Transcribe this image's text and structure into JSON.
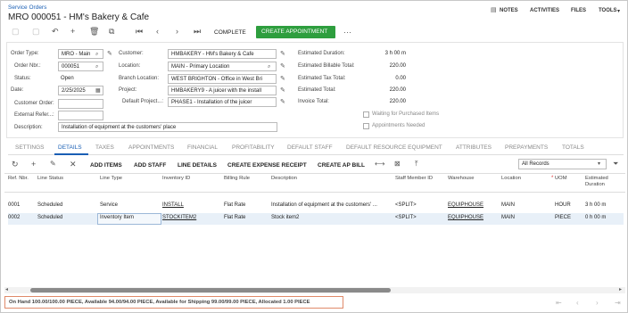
{
  "header": {
    "breadcrumb": "Service Orders",
    "title": "MRO 000051 - HM's Bakery & Cafe",
    "actions": [
      "NOTES",
      "ACTIVITIES",
      "FILES",
      "TOOLS"
    ]
  },
  "toolbar": {
    "complete_label": "COMPLETE",
    "create_appointment_label": "CREATE APPOINTMENT",
    "more_label": "···"
  },
  "form": {
    "order_type_label": "Order Type:",
    "order_type_value": "MRO - Main",
    "order_nbr_label": "Order Nbr.:",
    "order_nbr_value": "000051",
    "status_label": "Status:",
    "status_value": "Open",
    "date_label": "Date:",
    "date_value": "2/25/2025",
    "customer_order_label": "Customer Order:",
    "customer_order_value": "",
    "external_refer_label": "External Refer...:",
    "external_refer_value": "",
    "description_label": "Description:",
    "description_value": "Installation of equipment at the customers' place",
    "customer_label": "Customer:",
    "customer_value": "HMBAKERY - HM's Bakery & Cafe",
    "location_label": "Location:",
    "location_value": "MAIN - Primary Location",
    "branch_location_label": "Branch Location:",
    "branch_location_value": "WEST BRIGHTON - Office in West Bri",
    "project_label": "Project:",
    "project_value": "HMBAKERY9 - A juicer with the install",
    "default_project_label": "Default Project...:",
    "default_project_value": "PHASE1 - Installation of the juicer",
    "est_duration_label": "Estimated Duration:",
    "est_duration_value": "3 h 00 m",
    "est_billable_label": "Estimated Billable Total:",
    "est_billable_value": "220.00",
    "est_tax_label": "Estimated Tax Total:",
    "est_tax_value": "0.00",
    "est_total_label": "Estimated Total:",
    "est_total_value": "220.00",
    "invoice_total_label": "Invoice Total:",
    "invoice_total_value": "220.00",
    "waiting_label": "Waiting for Purchased Items",
    "appointments_needed_label": "Appointments Needed"
  },
  "tabs": [
    "SETTINGS",
    "DETAILS",
    "TAXES",
    "APPOINTMENTS",
    "FINANCIAL",
    "PROFITABILITY",
    "DEFAULT STAFF",
    "DEFAULT RESOURCE EQUIPMENT",
    "ATTRIBUTES",
    "PREPAYMENTS",
    "TOTALS"
  ],
  "active_tab": "DETAILS",
  "grid_toolbar": {
    "add_items": "ADD ITEMS",
    "add_staff": "ADD STAFF",
    "line_details": "LINE DETAILS",
    "create_expense_receipt": "CREATE EXPENSE RECEIPT",
    "create_ap_bill": "CREATE AP BILL",
    "filter_value": "All Records"
  },
  "grid": {
    "columns": [
      "Ref. Nbr.",
      "Line Status",
      "Line Type",
      "Inventory ID",
      "Billing Rule",
      "Description",
      "Staff Member ID",
      "Warehouse",
      "Location",
      "UOM",
      "Estimated Duration"
    ],
    "rows": [
      [
        "0001",
        "Scheduled",
        "Service",
        "INSTALL",
        "Flat Rate",
        "Installation of equipment at the customers' ...",
        "<SPLIT>",
        "EQUIPHOUSE",
        "MAIN",
        "HOUR",
        "3 h 00 m"
      ],
      [
        "0002",
        "Scheduled",
        "Inventory Item",
        "STOCKITEM2",
        "Flat Rate",
        "Stock item2",
        "<SPLIT>",
        "EQUIPHOUSE",
        "MAIN",
        "PIECE",
        "0 h 00 m"
      ]
    ]
  },
  "status_bar": "On Hand 100.00/100.00 PIECE, Available 94.00/94.00 PIECE, Available for Shipping 99.00/99.00 PIECE, Allocated 1.00 PIECE",
  "colors": {
    "accent": "#1a5fb4",
    "green": "#2e9e3e",
    "status_border": "#e08a6a"
  }
}
